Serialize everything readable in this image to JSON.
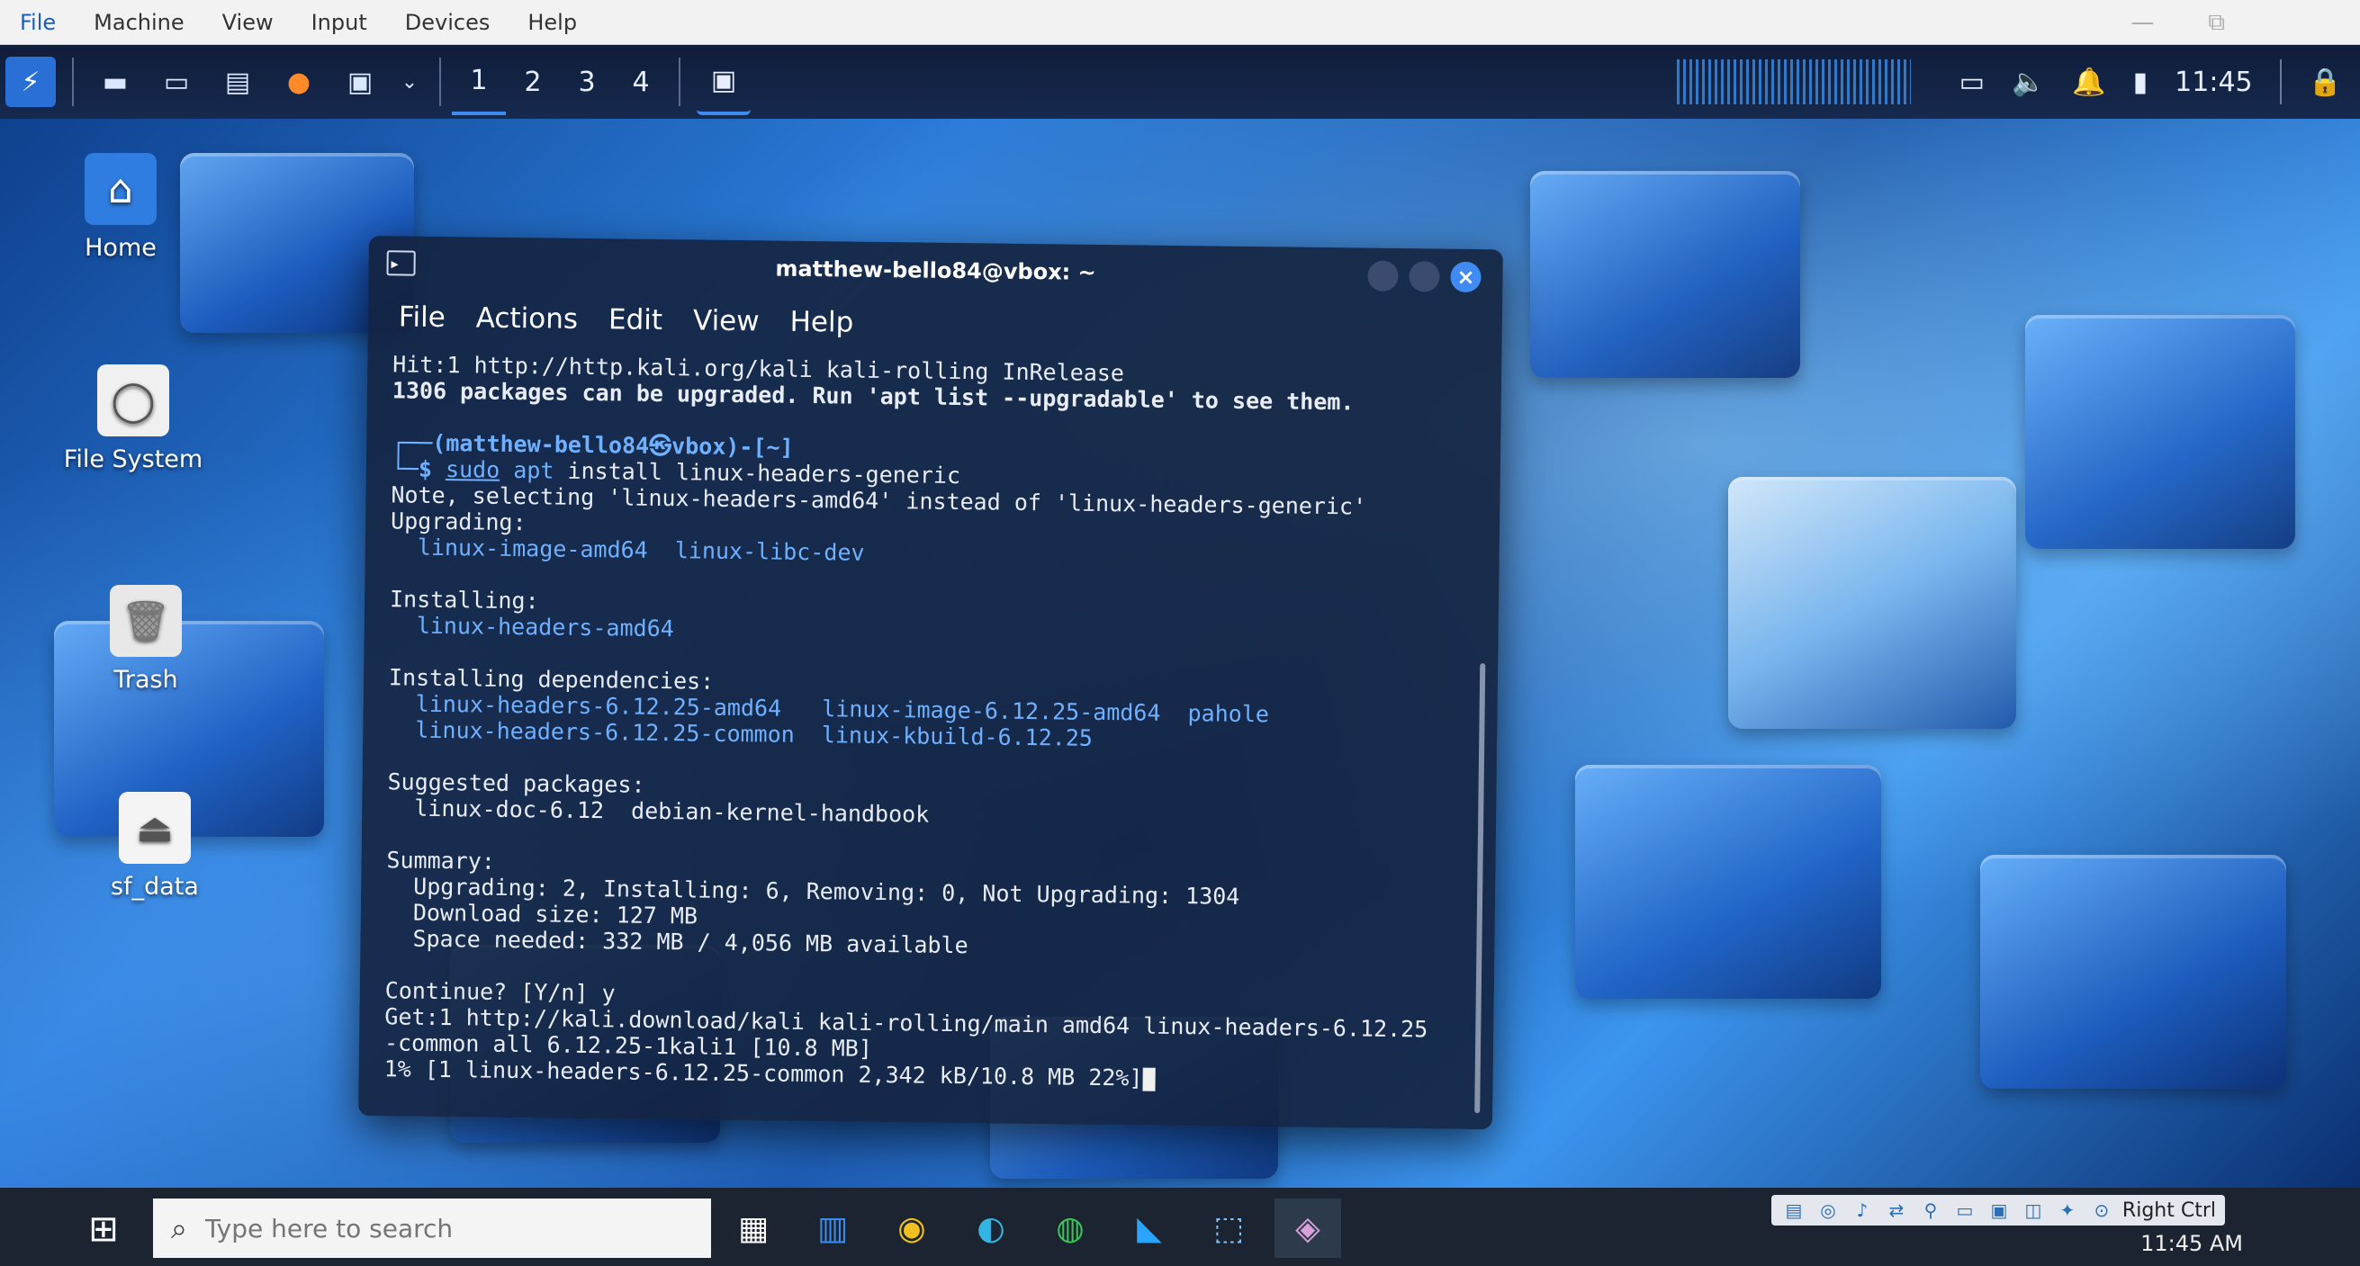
{
  "vbox_menu": {
    "items": [
      "File",
      "Machine",
      "View",
      "Input",
      "Devices",
      "Help"
    ],
    "window_controls": [
      "—",
      "⧉"
    ]
  },
  "kali_panel": {
    "workspaces": [
      "1",
      "2",
      "3",
      "4"
    ],
    "clock": "11:45"
  },
  "desktop_icons": [
    {
      "label": "Home",
      "icon": "home-icon"
    },
    {
      "label": "File System",
      "icon": "drive-icon"
    },
    {
      "label": "Trash",
      "icon": "trash-icon"
    },
    {
      "label": "sf_data",
      "icon": "eject-drive-icon"
    }
  ],
  "terminal": {
    "title": "matthew-bello84@vbox: ~",
    "menu": [
      "File",
      "Actions",
      "Edit",
      "View",
      "Help"
    ],
    "lines": {
      "l1": "Hit:1 http://http.kali.org/kali kali-rolling InRelease",
      "l2": "1306 packages can be upgraded. Run 'apt list --upgradable' to see them.",
      "prompt_user": "┌──(matthew-bello84㉿vbox)-[~]",
      "prompt_sym": "└─$ ",
      "cmd_sudo": "sudo",
      "cmd_apt": " apt",
      "cmd_rest": " install linux-headers-generic",
      "l5": "Note, selecting 'linux-headers-amd64' instead of 'linux-headers-generic'",
      "l6": "Upgrading:",
      "l7": "  linux-image-amd64  linux-libc-dev",
      "l9": "Installing:",
      "l10": "  linux-headers-amd64",
      "l12": "Installing dependencies:",
      "l13": "  linux-headers-6.12.25-amd64   linux-image-6.12.25-amd64  pahole",
      "l14": "  linux-headers-6.12.25-common  linux-kbuild-6.12.25",
      "l16": "Suggested packages:",
      "l17": "  linux-doc-6.12  debian-kernel-handbook",
      "l19": "Summary:",
      "l20": "  Upgrading: 2, Installing: 6, Removing: 0, Not Upgrading: 1304",
      "l21": "  Download size: 127 MB",
      "l22": "  Space needed: 332 MB / 4,056 MB available",
      "l24": "Continue? [Y/n] y",
      "l25": "Get:1 http://kali.download/kali kali-rolling/main amd64 linux-headers-6.12.25",
      "l26": "-common all 6.12.25-1kali1 [10.8 MB]",
      "l27": "1% [1 linux-headers-6.12.25-common 2,342 kB/10.8 MB 22%]"
    }
  },
  "win_taskbar": {
    "search_placeholder": "Type here to search",
    "host_key": "Right Ctrl",
    "clock": "11:45 AM"
  }
}
